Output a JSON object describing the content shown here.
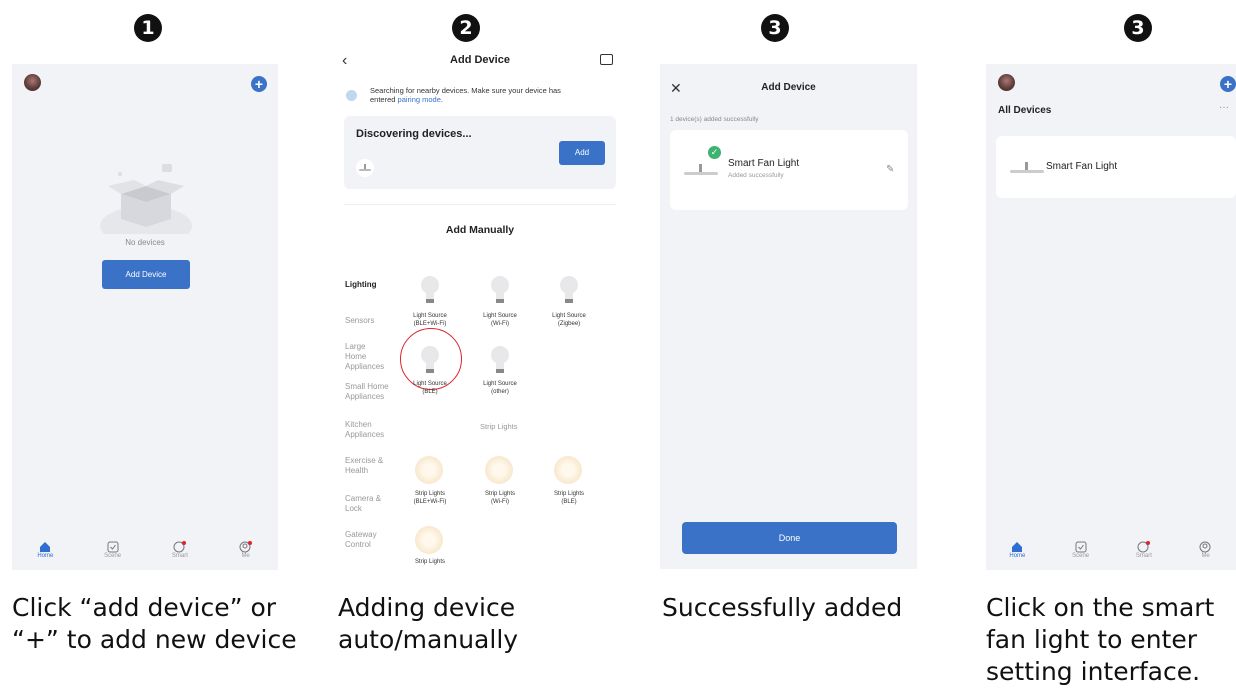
{
  "steps": [
    "1",
    "2",
    "3",
    "3"
  ],
  "captions": [
    [
      "Click “add device” or",
      "“+” to add new device"
    ],
    [
      "Adding device",
      "auto/manually"
    ],
    [
      "Successfully added"
    ],
    [
      "Click on the smart",
      "fan light to enter",
      "setting interface."
    ]
  ],
  "screen1": {
    "empty_text": "No devices",
    "add_button": "Add Device"
  },
  "nav": [
    "Home",
    "Scene",
    "Smart",
    "Me"
  ],
  "screen2": {
    "title": "Add Device",
    "search_line1": "Searching for nearby devices. Make sure your device has",
    "search_line2": "entered ",
    "pairing_link": "pairing mode",
    "search_end": ".",
    "discovering": "Discovering devices...",
    "add": "Add",
    "add_manually": "Add Manually",
    "categories": [
      "Lighting",
      "Sensors",
      "Large Home Appliances",
      "Small Home Appliances",
      "Kitchen Appliances",
      "Exercise & Health",
      "Camera & Lock",
      "Gateway Control"
    ],
    "devices": [
      {
        "l1": "Light Source",
        "l2": "(BLE+Wi-Fi)"
      },
      {
        "l1": "Light Source",
        "l2": "(Wi-Fi)"
      },
      {
        "l1": "Light Source",
        "l2": "(Zigbee)"
      },
      {
        "l1": "Light Source",
        "l2": "(BLE)"
      },
      {
        "l1": "Light Source",
        "l2": "(other)"
      },
      {
        "l1": "Strip Lights",
        "l2": "(BLE+Wi-Fi)"
      },
      {
        "l1": "Strip Lights",
        "l2": "(Wi-Fi)"
      },
      {
        "l1": "Strip Lights",
        "l2": "(BLE)"
      },
      {
        "l1": "Strip Lights",
        "l2": ""
      }
    ],
    "strip_header": "Strip Lights"
  },
  "screen3": {
    "title": "Add Device",
    "status": "1 device(s) added successfully",
    "device": "Smart Fan Light",
    "sub": "Added successfully",
    "done": "Done"
  },
  "screen4": {
    "header": "All Devices",
    "device": "Smart Fan Light"
  },
  "colors": {
    "accent": "#3a72c7",
    "screen_bg": "#f2f3f7",
    "highlight": "#d9262b"
  }
}
